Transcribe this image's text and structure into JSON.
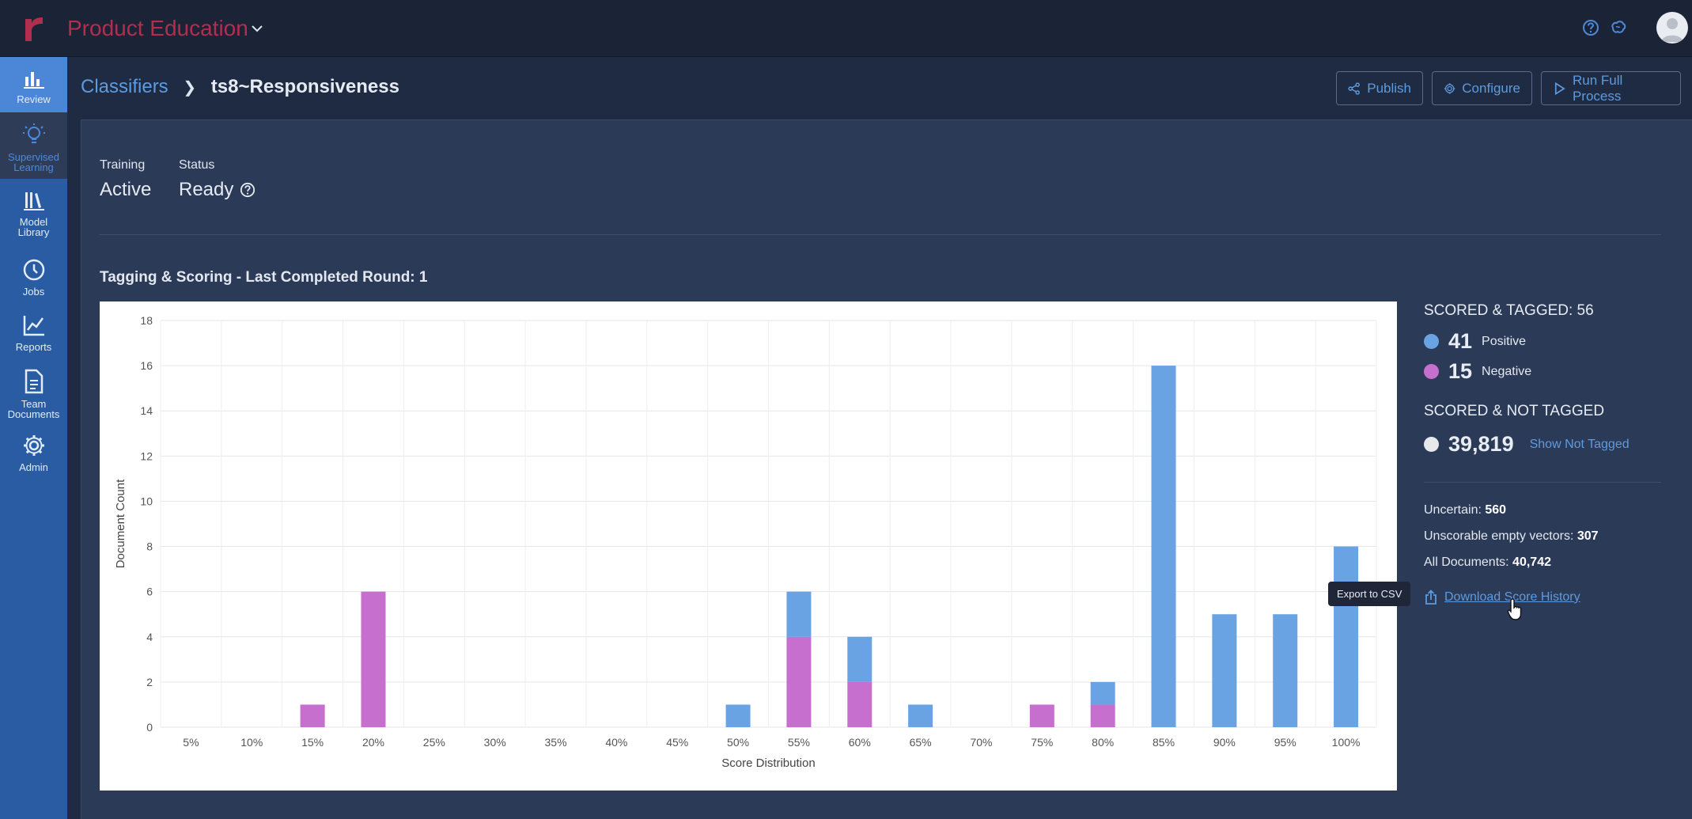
{
  "app": {
    "title": "Product Education"
  },
  "sidebar": {
    "items": [
      {
        "label": "Review",
        "icon": "bar-chart-icon"
      },
      {
        "label": "Supervised Learning",
        "icon": "lightbulb-icon"
      },
      {
        "label": "Model Library",
        "icon": "books-icon"
      },
      {
        "label": "Jobs",
        "icon": "clock-icon"
      },
      {
        "label": "Reports",
        "icon": "line-chart-icon"
      },
      {
        "label": "Team Documents",
        "icon": "document-icon"
      },
      {
        "label": "Admin",
        "icon": "gear-icon"
      }
    ]
  },
  "breadcrumb": {
    "parent": "Classifiers",
    "current": "ts8~Responsiveness"
  },
  "header_buttons": {
    "publish": "Publish",
    "configure": "Configure",
    "run": "Run Full Process"
  },
  "meta": {
    "training_label": "Training",
    "training_value": "Active",
    "status_label": "Status",
    "status_value": "Ready"
  },
  "section_title": "Tagging & Scoring - Last Completed Round: 1",
  "stats": {
    "scored_tagged": "SCORED & TAGGED: 56",
    "positive_count": "41",
    "positive_label": "Positive",
    "negative_count": "15",
    "negative_label": "Negative",
    "scored_not_tagged": "SCORED & NOT TAGGED",
    "not_tagged_count": "39,819",
    "show_not_tagged": "Show Not Tagged",
    "uncertain_label": "Uncertain:",
    "uncertain_value": "560",
    "unscorable_label": "Unscorable empty vectors:",
    "unscorable_value": "307",
    "all_label": "All Documents:",
    "all_value": "40,742",
    "download": "Download Score History",
    "tooltip": "Export to CSV"
  },
  "colors": {
    "positive": "#6aa3e4",
    "negative": "#c66fce",
    "not_tagged": "#e6e8ec"
  },
  "chart_data": {
    "type": "bar",
    "stacked": true,
    "categories": [
      "5%",
      "10%",
      "15%",
      "20%",
      "25%",
      "30%",
      "35%",
      "40%",
      "45%",
      "50%",
      "55%",
      "60%",
      "65%",
      "70%",
      "75%",
      "80%",
      "85%",
      "90%",
      "95%",
      "100%"
    ],
    "series": [
      {
        "values": [
          0,
          0,
          1,
          6,
          0,
          0,
          0,
          0,
          0,
          0,
          4,
          2,
          0,
          0,
          1,
          1,
          0,
          0,
          0,
          0
        ],
        "color": "#c66fce"
      },
      {
        "values": [
          0,
          0,
          0,
          0,
          0,
          0,
          0,
          0,
          0,
          1,
          2,
          2,
          1,
          0,
          0,
          1,
          16,
          5,
          5,
          8
        ],
        "color": "#6aa3e4"
      }
    ],
    "xlabel": "Score Distribution",
    "ylabel": "Document Count",
    "ylim": [
      0,
      18
    ],
    "yticks": [
      0,
      2,
      4,
      6,
      8,
      10,
      12,
      14,
      16,
      18
    ],
    "grid": true
  }
}
